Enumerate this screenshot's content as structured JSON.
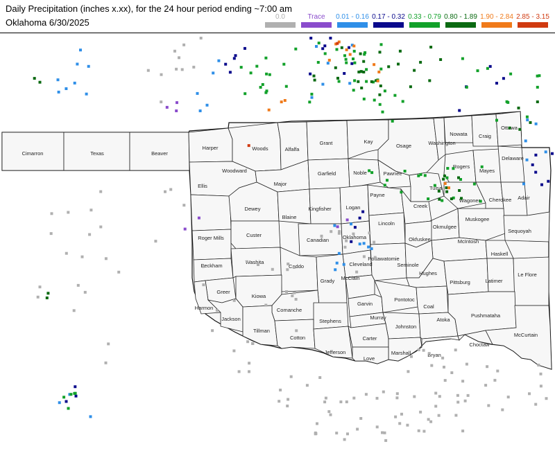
{
  "header": {
    "title": "Daily Precipitation (inches  x.xx),  for the 24 hour period ending ~7:00 am",
    "subtitle": "Oklahoma 6/30/2025"
  },
  "legend": [
    {
      "label": "0.0",
      "color": "#b0b0b0"
    },
    {
      "label": "Trace",
      "color": "#8a4ccc"
    },
    {
      "label": "0.01 - 0.16",
      "color": "#2f8fe8"
    },
    {
      "label": "0.17 - 0.32",
      "color": "#0a0a8c"
    },
    {
      "label": "0.33 - 0.79",
      "color": "#12a12a"
    },
    {
      "label": "0.80 - 1.89",
      "color": "#0b6a12"
    },
    {
      "label": "1.90 - 2.84",
      "color": "#f07a1a"
    },
    {
      "label": "2.85 - 3.15",
      "color": "#d03a10"
    }
  ],
  "counties": [
    "Cimarron",
    "Texas",
    "Beaver",
    "Harper",
    "Woods",
    "Alfalfa",
    "Grant",
    "Kay",
    "Osage",
    "Washington",
    "Nowata",
    "Craig",
    "Ottawa",
    "Woodward",
    "Major",
    "Garfield",
    "Noble",
    "Pawnee",
    "Rogers",
    "Mayes",
    "Delaware",
    "Ellis",
    "Dewey",
    "Blaine",
    "Kingfisher",
    "Logan",
    "Payne",
    "Tulsa",
    "Creek",
    "Wagoner",
    "Cherokee",
    "Adair",
    "Roger Mills",
    "Custer",
    "Canadian",
    "Oklahoma",
    "Lincoln",
    "Okmulgee",
    "Muskogee",
    "Sequoyah",
    "Okfuskee",
    "McIntosh",
    "Beckham",
    "Washita",
    "Caddo",
    "Cleveland",
    "Pottawatomie",
    "Seminole",
    "Haskell",
    "Grady",
    "McClain",
    "Hughes",
    "Pittsburg",
    "Latimer",
    "Le Flore",
    "Greer",
    "Kiowa",
    "Harmon",
    "Jackson",
    "Comanche",
    "Stephens",
    "Garvin",
    "Pontotoc",
    "Coal",
    "Murray",
    "Johnston",
    "Atoka",
    "Pushmataha",
    "Tillman",
    "Cotton",
    "Jefferson",
    "Carter",
    "Marshall",
    "Love",
    "Bryan",
    "Choctaw",
    "McCurtain"
  ],
  "stations_summary": {
    "0.0": "many",
    "Trace": "few",
    "0.01 - 0.16": "scattered",
    "0.17 - 0.32": "scattered",
    "0.33 - 0.79": "numerous north and northeast",
    "0.80 - 1.89": "numerous north and northeast",
    "1.90 - 2.84": "few north",
    "2.85 - 3.15": "isolated"
  }
}
